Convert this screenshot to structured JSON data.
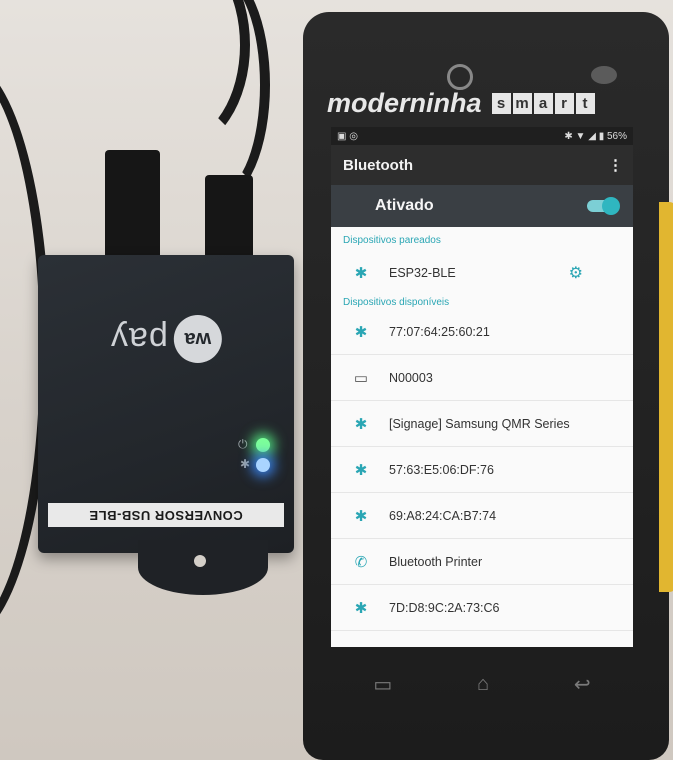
{
  "converter": {
    "brand_mark": "wa",
    "brand_word": "pay",
    "label": "CONVERSOR USB-BLE",
    "led_power_icon": "power-icon",
    "led_bt_icon": "bluetooth-icon",
    "led_colors": {
      "power": "#7dff9a",
      "bluetooth": "#3c8cff"
    }
  },
  "phone": {
    "brand_word": "moderninha",
    "brand_letters": [
      "s",
      "m",
      "a",
      "r",
      "t"
    ],
    "status": {
      "battery": "56%"
    },
    "appbar": {
      "title": "Bluetooth",
      "menu_icon": "⋮"
    },
    "toggle": {
      "label": "Ativado",
      "state": "on"
    },
    "paired": {
      "header": "Dispositivos pareados",
      "items": [
        {
          "name": "ESP32-BLE",
          "icon": "bluetooth-icon"
        }
      ]
    },
    "available": {
      "header": "Dispositivos disponíveis",
      "items": [
        {
          "name": "77:07:64:25:60:21",
          "icon": "bluetooth-icon"
        },
        {
          "name": "N00003",
          "icon": "laptop-icon"
        },
        {
          "name": "[Signage] Samsung QMR Series",
          "icon": "bluetooth-icon"
        },
        {
          "name": "57:63:E5:06:DF:76",
          "icon": "bluetooth-icon"
        },
        {
          "name": "69:A8:24:CA:B7:74",
          "icon": "bluetooth-icon"
        },
        {
          "name": "Bluetooth Printer",
          "icon": "phone-icon"
        },
        {
          "name": "7D:D8:9C:2A:73:C6",
          "icon": "bluetooth-icon"
        }
      ]
    },
    "accent_color": "#2aa6b4"
  }
}
